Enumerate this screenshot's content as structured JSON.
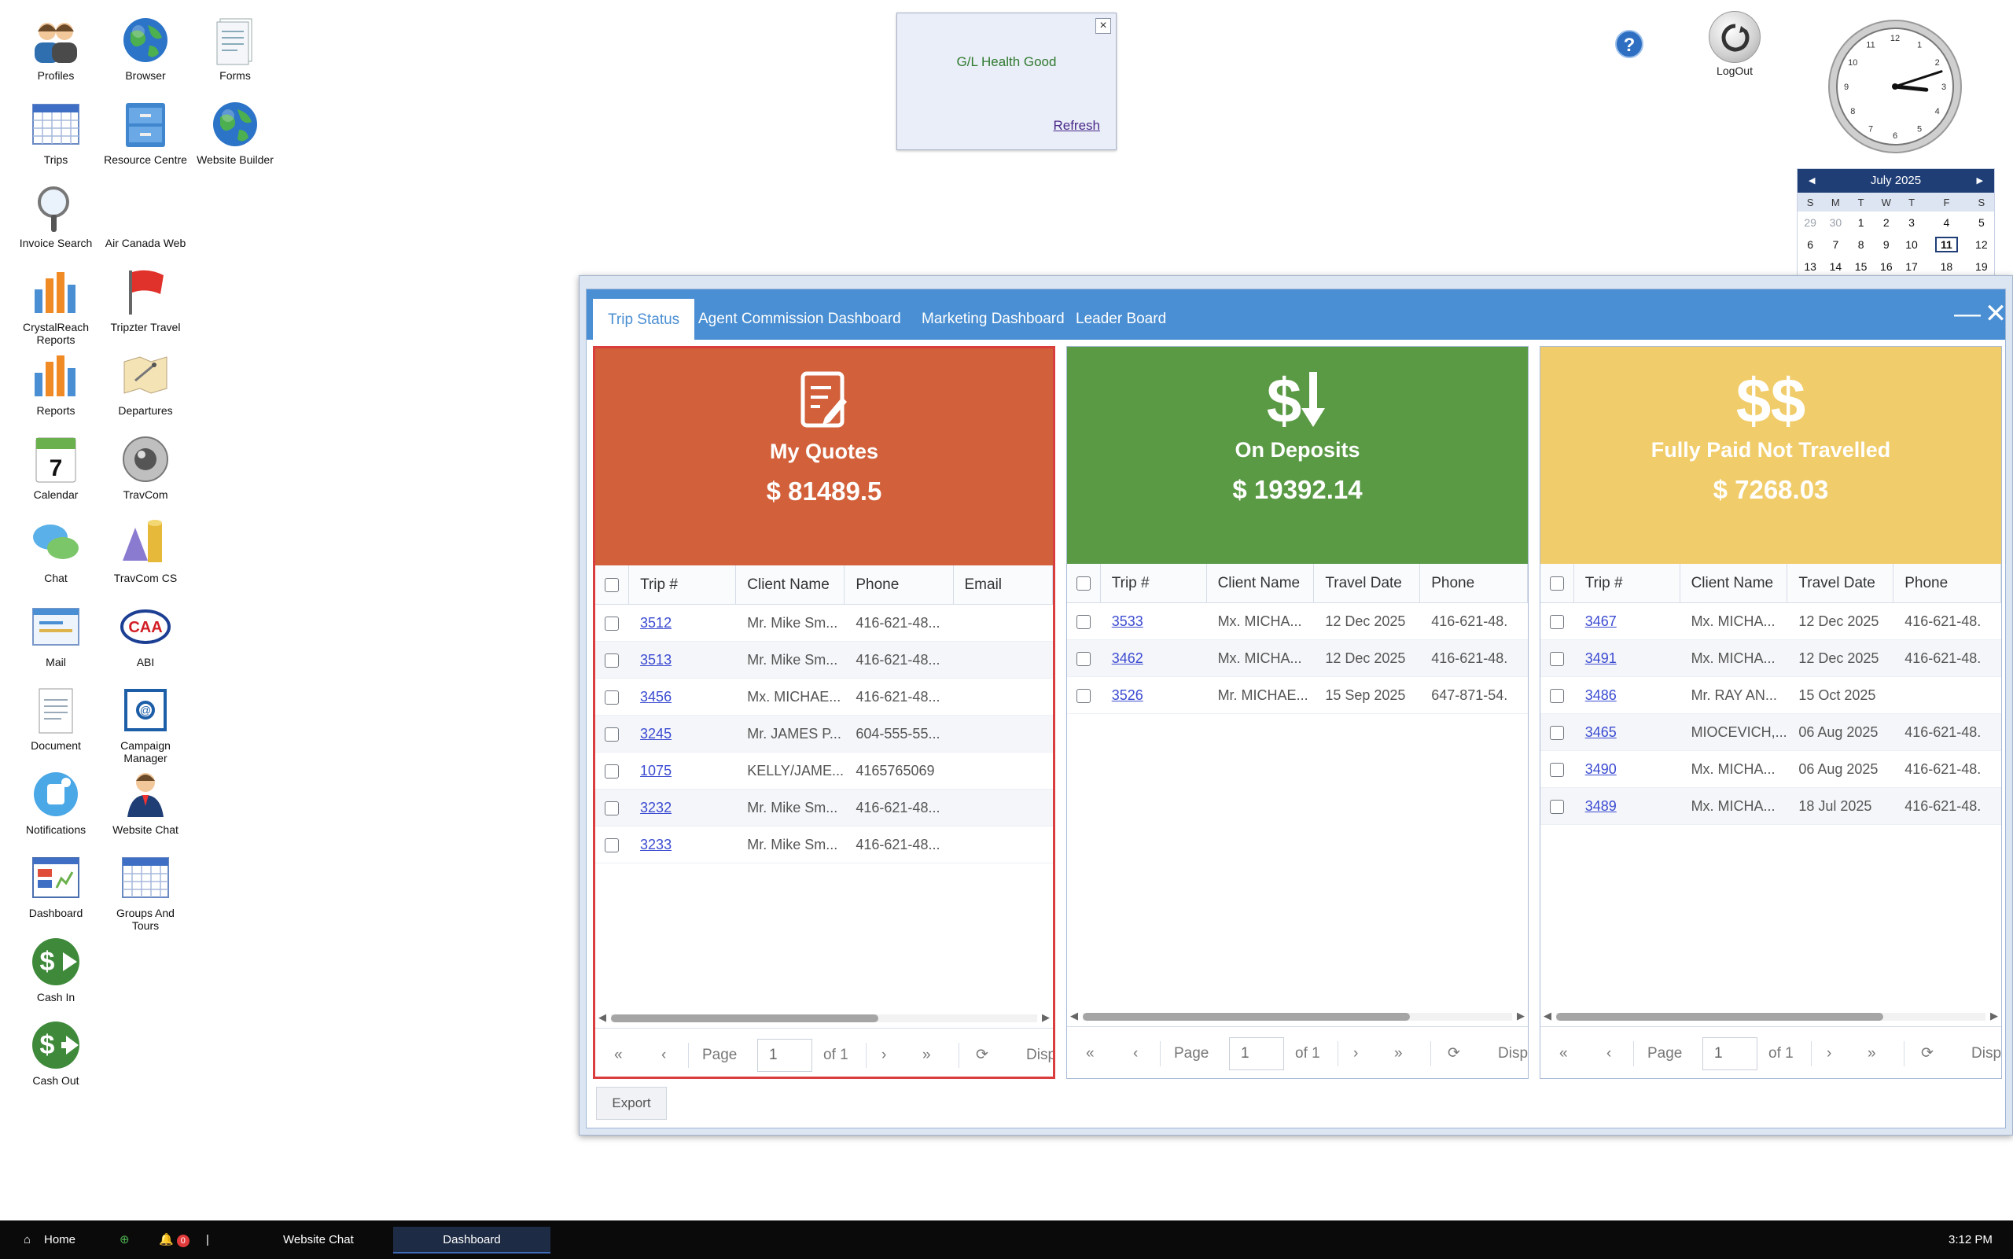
{
  "desktop_icons": [
    {
      "label": "Profiles",
      "icon": "profiles-icon"
    },
    {
      "label": "Browser",
      "icon": "globe-icon"
    },
    {
      "label": "Forms",
      "icon": "forms-icon"
    },
    {
      "label": "Trips",
      "icon": "calendar-grid-icon"
    },
    {
      "label": "Resource Centre",
      "icon": "file-cabinet-icon"
    },
    {
      "label": "Website Builder",
      "icon": "globe-icon"
    },
    {
      "label": "Invoice Search",
      "icon": "magnifier-icon"
    },
    {
      "label": "Air Canada Web",
      "icon": "blank-icon"
    },
    {
      "label": "CrystalReach Reports",
      "icon": "bar-chart-icon"
    },
    {
      "label": "Tripzter Travel",
      "icon": "flag-icon"
    },
    {
      "label": "Reports",
      "icon": "bar-chart-icon"
    },
    {
      "label": "Departures",
      "icon": "map-icon"
    },
    {
      "label": "Calendar",
      "icon": "calendar-day-icon"
    },
    {
      "label": "TravCom",
      "icon": "disc-icon"
    },
    {
      "label": "Chat",
      "icon": "chat-bubbles-icon"
    },
    {
      "label": "TravCom CS",
      "icon": "shapes-icon"
    },
    {
      "label": "Mail",
      "icon": "mail-window-icon"
    },
    {
      "label": "ABI",
      "icon": "caa-logo-icon"
    },
    {
      "label": "Document",
      "icon": "document-icon"
    },
    {
      "label": "Campaign Manager",
      "icon": "campaign-envelope-icon"
    },
    {
      "label": "Notifications",
      "icon": "notification-icon"
    },
    {
      "label": "Website Chat",
      "icon": "agent-person-icon"
    },
    {
      "label": "Dashboard",
      "icon": "dashboard-icon"
    },
    {
      "label": "Groups And Tours",
      "icon": "calendar-grid-icon"
    },
    {
      "label": "Cash In",
      "icon": "cash-in-icon"
    },
    {
      "label": "Cash Out",
      "icon": "cash-out-icon"
    }
  ],
  "health": {
    "text": "G/L Health Good",
    "refresh": "Refresh",
    "close": "×"
  },
  "help": {
    "label": "?"
  },
  "logout": {
    "label": "LogOut"
  },
  "clock": {
    "hour": 3,
    "minute": 12
  },
  "calendar": {
    "month": "July 2025",
    "days": [
      "S",
      "M",
      "T",
      "W",
      "T",
      "F",
      "S"
    ],
    "weeks": [
      [
        "29",
        "30",
        "1",
        "2",
        "3",
        "4",
        "5"
      ],
      [
        "6",
        "7",
        "8",
        "9",
        "10",
        "11",
        "12"
      ],
      [
        "13",
        "14",
        "15",
        "16",
        "17",
        "18",
        "19"
      ]
    ],
    "today": "11"
  },
  "dashboard": {
    "tabs": [
      "Trip Status",
      "Agent Commission Dashboard",
      "Marketing Dashboard",
      "Leader Board"
    ],
    "active_tab": "Trip Status",
    "minimize": "—",
    "close": "✕",
    "export": "Export",
    "panels": [
      {
        "title": "My Quotes",
        "amount": "$ 81489.5",
        "color": "#d2603a",
        "icon": "quote-document-icon",
        "columns": [
          "Trip #",
          "Client Name",
          "Phone",
          "Email"
        ],
        "rows": [
          [
            "3512",
            "Mr. Mike Sm...",
            "416-621-48...",
            ""
          ],
          [
            "3513",
            "Mr. Mike Sm...",
            "416-621-48...",
            ""
          ],
          [
            "3456",
            "Mx. MICHAE...",
            "416-621-48...",
            ""
          ],
          [
            "3245",
            "Mr. JAMES P...",
            "604-555-55...",
            ""
          ],
          [
            "1075",
            "KELLY/JAME...",
            "4165765069",
            ""
          ],
          [
            "3232",
            "Mr. Mike Sm...",
            "416-621-48...",
            ""
          ],
          [
            "3233",
            "Mr. Mike Sm...",
            "416-621-48...",
            ""
          ]
        ],
        "pager": {
          "page_label": "Page",
          "page": "1",
          "of": "of 1",
          "disp": "Disp"
        }
      },
      {
        "title": "On Deposits",
        "amount": "$ 19392.14",
        "color": "#5a9a45",
        "icon": "dollar-down-icon",
        "columns": [
          "Trip #",
          "Client Name",
          "Travel Date",
          "Phone"
        ],
        "rows": [
          [
            "3533",
            "Mx. MICHA...",
            "12 Dec 2025",
            "416-621-48."
          ],
          [
            "3462",
            "Mx. MICHA...",
            "12 Dec 2025",
            "416-621-48."
          ],
          [
            "3526",
            "Mr. MICHAE...",
            "15 Sep 2025",
            "647-871-54."
          ]
        ],
        "pager": {
          "page_label": "Page",
          "page": "1",
          "of": "of 1",
          "disp": "Disp"
        }
      },
      {
        "title": "Fully Paid Not Travelled",
        "amount": "$ 7268.03",
        "color": "#f1cc6a",
        "icon": "double-dollar-icon",
        "columns": [
          "Trip #",
          "Client Name",
          "Travel Date",
          "Phone"
        ],
        "rows": [
          [
            "3467",
            "Mx. MICHA...",
            "12 Dec 2025",
            "416-621-48."
          ],
          [
            "3491",
            "Mx. MICHA...",
            "12 Dec 2025",
            "416-621-48."
          ],
          [
            "3486",
            "Mr. RAY AN...",
            "15 Oct 2025",
            ""
          ],
          [
            "3465",
            "MIOCEVICH,...",
            "06 Aug 2025",
            "416-621-48."
          ],
          [
            "3490",
            "Mx. MICHA...",
            "06 Aug 2025",
            "416-621-48."
          ],
          [
            "3489",
            "Mx. MICHA...",
            "18 Jul 2025",
            "416-621-48."
          ]
        ],
        "pager": {
          "page_label": "Page",
          "page": "1",
          "of": "of 1",
          "disp": "Disp"
        }
      }
    ]
  },
  "taskbar": {
    "home": "Home",
    "badge": "0",
    "items": [
      "Website Chat",
      "Dashboard"
    ],
    "active": "Dashboard",
    "time": "3:12 PM"
  }
}
